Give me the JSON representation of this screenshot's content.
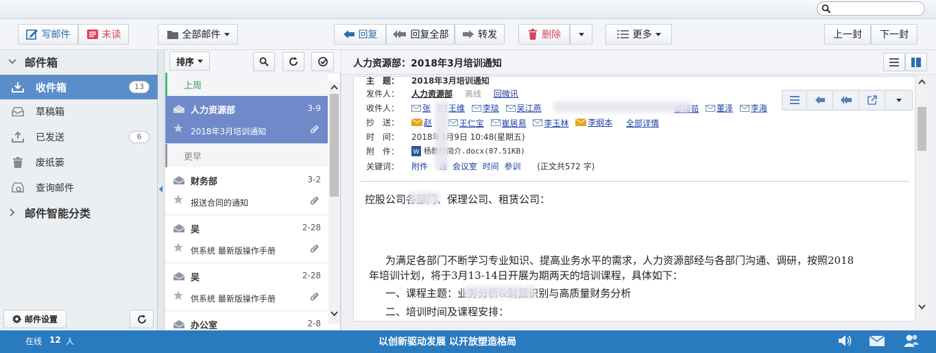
{
  "search": {
    "placeholder": ""
  },
  "toolbar": {
    "compose_label": "写邮件",
    "unread_label": "未读",
    "all_mail_label": "全部邮件",
    "reply_label": "回复",
    "reply_all_label": "回复全部",
    "forward_label": "转发",
    "delete_label": "删除",
    "more_label": "更多",
    "prev_label": "上一封",
    "next_label": "下一封"
  },
  "sidebar": {
    "mailbox_title": "邮件箱",
    "items": [
      {
        "label": "收件箱",
        "count": "13"
      },
      {
        "label": "草稿箱",
        "count": ""
      },
      {
        "label": "已发送",
        "count": "6"
      },
      {
        "label": "废纸篓",
        "count": ""
      },
      {
        "label": "查询邮件",
        "count": ""
      }
    ],
    "smart_title": "邮件智能分类",
    "settings_label": "邮件设置"
  },
  "list": {
    "sort_label": "排序",
    "group_last_week": "上周",
    "group_earlier": "更早",
    "messages": [
      {
        "sender": "人力资源部",
        "date": "3-9",
        "subject": "2018年3月培训通知"
      },
      {
        "sender": "财务部",
        "date": "3-2",
        "subject": "报送合同的通知"
      },
      {
        "sender": "吴",
        "date": "2-28",
        "subject": "供系统 最新版操作手册"
      },
      {
        "sender": "吴",
        "date": "2-28",
        "subject": "供系统 最新版操作手册"
      },
      {
        "sender": "办公室",
        "date": "2-8",
        "subject": ""
      }
    ]
  },
  "reader": {
    "subject_title": "人力资源部：2018年3月培训通知",
    "header": {
      "subject_label": "主　题：",
      "subject_value": "2018年3月培训通知",
      "from_label": "发件人：",
      "from_name": "人力资源部",
      "from_status": "离线",
      "from_action": "回微讯",
      "to_label": "收件人：",
      "to_names": [
        "张",
        "王维",
        "李琰",
        "吴江燕",
        "邵靖茹",
        "董泽",
        "李海"
      ],
      "cc_label": "抄　送：",
      "cc_names": [
        "赵",
        "王仁宝",
        "崔居易",
        "李玉林",
        "李纲本"
      ],
      "cc_all": "全部详情",
      "time_label": "时　间：",
      "time_value": "2018年3月9日 10:48(星期五)",
      "attach_label": "附　件：",
      "attach_value": "杨教授简介.docx(87.51KB)",
      "keywords_label": "关键词：",
      "keywords": [
        "附件",
        "通",
        "会议室",
        "时间",
        "参训"
      ],
      "word_count": "(正文共572 字)"
    },
    "body": [
      "控股公司各部门、保理公司、租赁公司：",
      "为满足各部门不断学习专业知识、提高业务水平的需求，人力资源部经与各部门沟通、调研，按照2018",
      "年培训计划，将于3月13-14日开展为期两天的培训课程，具体如下：",
      "一、课程主题：业务分析&财报识别与高质量财务分析",
      "二、培训时间及课程安排："
    ]
  },
  "status": {
    "online_label": "在线",
    "online_count": "12",
    "online_unit": "人",
    "slogan": "以创新驱动发展 以开放塑造格局"
  },
  "colors": {
    "accent": "#2a7ac0",
    "selected": "#6f89c9",
    "delete_red": "#d9435b",
    "compose_blue": "#2a6db5"
  }
}
